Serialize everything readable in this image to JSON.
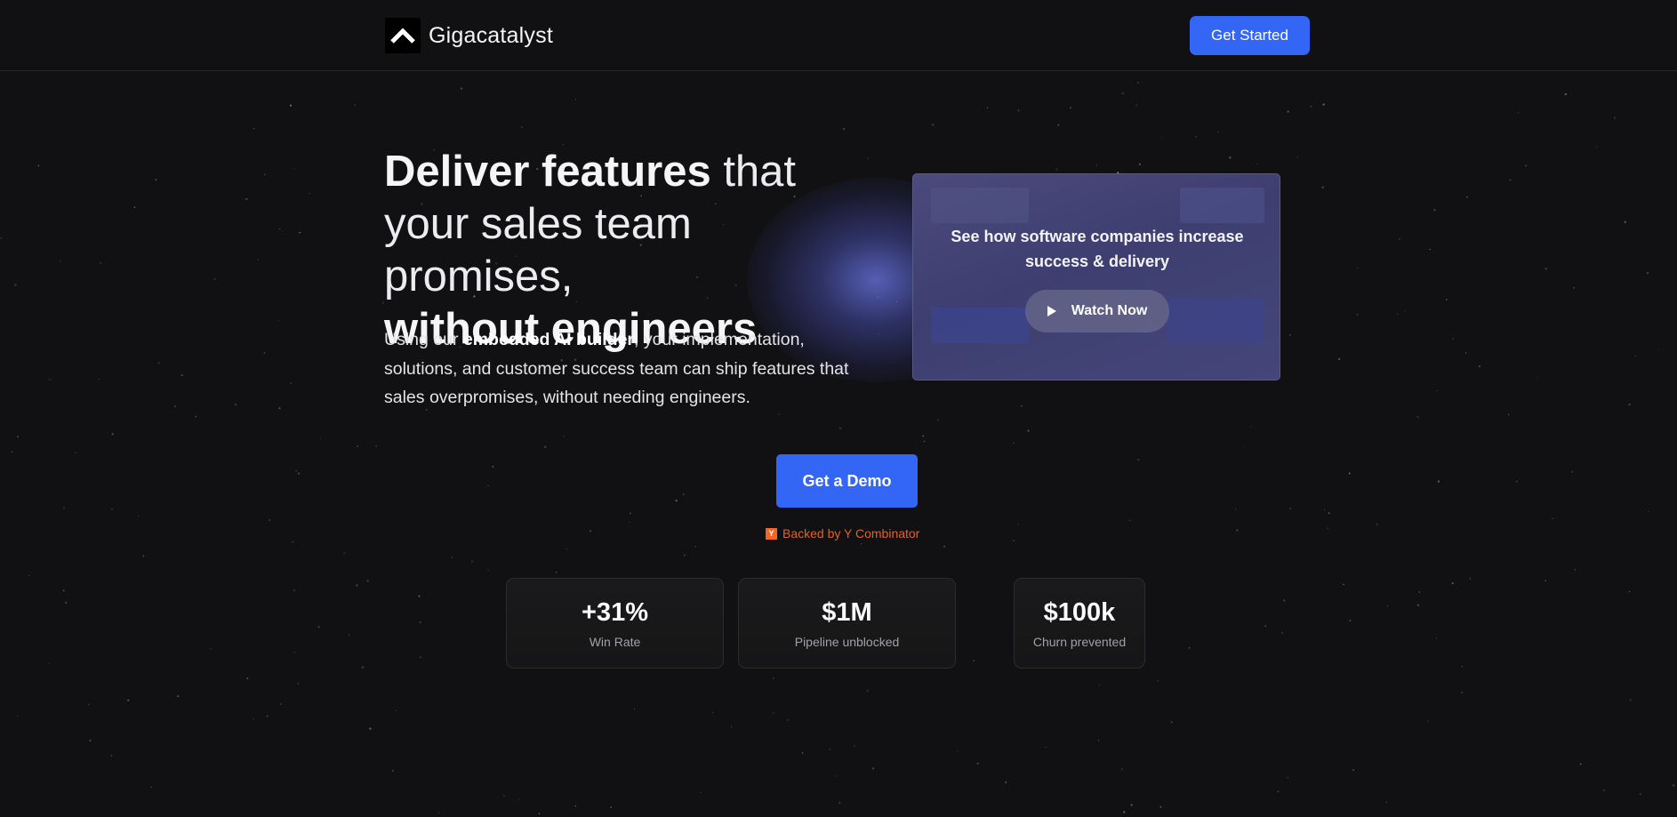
{
  "header": {
    "brand_name": "Gigacatalyst",
    "cta_label": "Get Started"
  },
  "hero": {
    "headline": {
      "part1_bold": "Deliver features",
      "part2_light": " that your sales team promises,",
      "part3_bold": "without engineers"
    },
    "subtext": {
      "lead": "Using our ",
      "emphasis": "embedded AI builder",
      "rest": ", your implementation, solutions, and customer success team can ship features that sales overpromises, without needing engineers."
    }
  },
  "video_card": {
    "title": "See how software companies increase success & delivery",
    "button_label": "Watch Now"
  },
  "cta": {
    "demo_label": "Get a Demo",
    "backer_badge": "Y",
    "backer_text": "Backed by Y Combinator"
  },
  "stats": [
    {
      "value": "+31%",
      "label": "Win Rate"
    },
    {
      "value": "$1M",
      "label": "Pipeline unblocked"
    },
    {
      "value": "$100k",
      "label": "Churn prevented"
    }
  ],
  "colors": {
    "background": "#111113",
    "accent": "#3366f5",
    "yc_orange": "#f26522"
  }
}
